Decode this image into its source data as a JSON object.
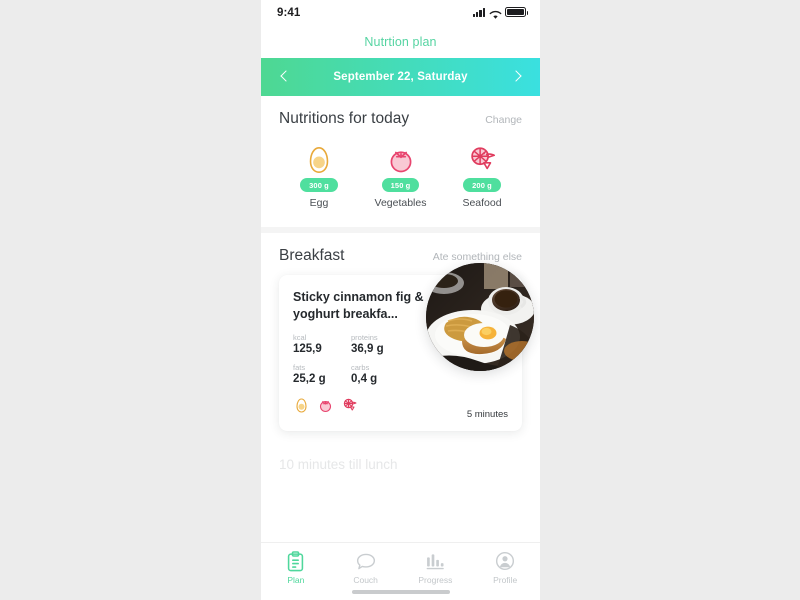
{
  "theme": {
    "accent_green": "#56d4a2",
    "pill_green": "#4fdf9e",
    "gradient_from": "#4ed892",
    "gradient_to": "#3ae0e0",
    "egg_color": "#e8a93a",
    "veg_color": "#e8456f",
    "seafood_color": "#e03c5e",
    "page_background": "#ececec",
    "screen_background": "#ffffff"
  },
  "status_bar": {
    "time": "9:41",
    "signal_icon": "cellular-signal-icon",
    "wifi_icon": "wifi-icon",
    "battery_icon": "battery-full-icon"
  },
  "header": {
    "title": "Nutrtion plan"
  },
  "date_selector": {
    "prev_icon": "chevron-left-icon",
    "next_icon": "chevron-right-icon",
    "label": "September 22, Saturday"
  },
  "nutritions": {
    "title": "Nutritions for today",
    "action_label": "Change",
    "items": [
      {
        "name": "Egg",
        "amount": "300 g",
        "icon": "egg-icon"
      },
      {
        "name": "Vegetables",
        "amount": "150 g",
        "icon": "tomato-icon"
      },
      {
        "name": "Seafood",
        "amount": "200 g",
        "icon": "shrimp-icon"
      }
    ]
  },
  "breakfast": {
    "title": "Breakfast",
    "action_label": "Ate something else",
    "meal": {
      "name": "Sticky cinnamon fig & yoghurt breakfa...",
      "photo_icon": "breakfast-plate-photo",
      "prep_time": "5 minutes",
      "macros": [
        {
          "key": "kcal",
          "value": "125,9"
        },
        {
          "key": "proteins",
          "value": "36,9 g"
        },
        {
          "key": "fats",
          "value": "25,2 g"
        },
        {
          "key": "carbs",
          "value": "0,4 g"
        }
      ],
      "tags": [
        {
          "icon": "egg-icon"
        },
        {
          "icon": "tomato-icon"
        },
        {
          "icon": "shrimp-icon"
        }
      ]
    }
  },
  "countdown": {
    "text": "10 minutes till lunch"
  },
  "tab_bar": {
    "items": [
      {
        "label": "Plan",
        "icon": "clipboard-icon",
        "active": true
      },
      {
        "label": "Couch",
        "icon": "speech-bubble-icon",
        "active": false
      },
      {
        "label": "Progress",
        "icon": "bar-chart-icon",
        "active": false
      },
      {
        "label": "Profile",
        "icon": "person-circle-icon",
        "active": false
      }
    ],
    "home_indicator": "home-indicator"
  }
}
